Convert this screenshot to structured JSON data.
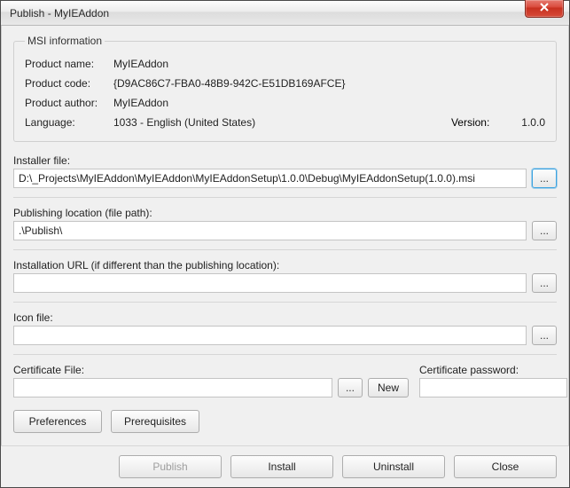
{
  "window": {
    "title": "Publish - MyIEAddon"
  },
  "msi": {
    "legend": "MSI information",
    "product_name_label": "Product name:",
    "product_name": "MyIEAddon",
    "product_code_label": "Product code:",
    "product_code": "{D9AC86C7-FBA0-48B9-942C-E51DB169AFCE}",
    "product_author_label": "Product author:",
    "product_author": "MyIEAddon",
    "language_label": "Language:",
    "language": "1033 - English (United States)",
    "version_label": "Version:",
    "version": "1.0.0"
  },
  "fields": {
    "installer_label": "Installer file:",
    "installer_value": "D:\\_Projects\\MyIEAddon\\MyIEAddon\\MyIEAddonSetup\\1.0.0\\Debug\\MyIEAddonSetup(1.0.0).msi",
    "publish_loc_label": "Publishing location (file path):",
    "publish_loc_value": ".\\Publish\\",
    "install_url_label": "Installation URL (if different than the publishing location):",
    "install_url_value": "",
    "icon_label": "Icon file:",
    "icon_value": "",
    "cert_file_label": "Certificate File:",
    "cert_file_value": "",
    "cert_pass_label": "Certificate password:",
    "cert_pass_value": ""
  },
  "buttons": {
    "browse": "...",
    "new": "New",
    "preferences": "Preferences",
    "prerequisites": "Prerequisites",
    "publish": "Publish",
    "install": "Install",
    "uninstall": "Uninstall",
    "close": "Close"
  }
}
